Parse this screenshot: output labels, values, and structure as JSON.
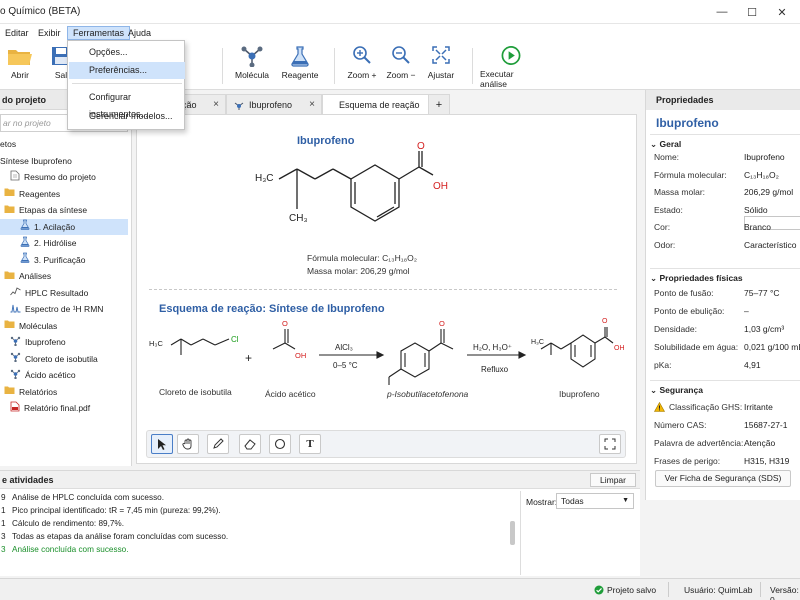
{
  "window": {
    "title": "o Químico (BETA)",
    "minimize": "—",
    "maximize": "☐",
    "close": "✕"
  },
  "menu": {
    "items": [
      "Editar",
      "Exibir",
      "Ferramentas",
      "Ajuda"
    ],
    "active": "Ferramentas"
  },
  "dropdown": {
    "items": [
      "Opções...",
      "Preferências...",
      "Configurar instrumentos...",
      "Gerenciar modelos..."
    ],
    "highlighted": "Preferências..."
  },
  "toolbar": {
    "abrir": "Abrir",
    "salvar": "Sal",
    "molecula": "Molécula",
    "reagente": "Reagente",
    "zoom_in": "Zoom +",
    "zoom_out": "Zoom −",
    "ajustar": "Ajustar",
    "executar": "Executar análise"
  },
  "left_panel": {
    "title": "do projeto",
    "search_placeholder": "ar no projeto",
    "tree": [
      {
        "label": "etos",
        "icon": "none"
      },
      {
        "label": "Síntese Ibuprofeno",
        "icon": "none"
      },
      {
        "label": "Resumo do projeto",
        "icon": "doc-icon"
      },
      {
        "label": "Reagentes",
        "icon": "folder-icon"
      },
      {
        "label": "Etapas da síntese",
        "icon": "folder-icon"
      },
      {
        "label": "1. Acilação",
        "icon": "flask-icon",
        "selected": true
      },
      {
        "label": "2. Hidrólise",
        "icon": "flask-icon"
      },
      {
        "label": "3. Purificação",
        "icon": "flask-icon"
      },
      {
        "label": "Análises",
        "icon": "folder-icon"
      },
      {
        "label": "HPLC Resultado",
        "icon": "chart-icon"
      },
      {
        "label": "Espectro de ¹H RMN",
        "icon": "spectrum-icon"
      },
      {
        "label": "Moléculas",
        "icon": "folder-icon"
      },
      {
        "label": "Ibuprofeno",
        "icon": "molecule-icon"
      },
      {
        "label": "Cloreto de isobutila",
        "icon": "molecule-icon"
      },
      {
        "label": "Ácido acético",
        "icon": "molecule-icon"
      },
      {
        "label": "Relatórios",
        "icon": "folder-icon"
      },
      {
        "label": "Relatório final.pdf",
        "icon": "pdf-icon"
      }
    ]
  },
  "tabs": [
    {
      "label": "lação"
    },
    {
      "label": "Ibuprofeno"
    },
    {
      "label": "Esquema de reação",
      "active": true
    },
    {
      "label": "+"
    }
  ],
  "canvas": {
    "molecule_title": "Ibuprofeno",
    "formula_label": "Fórmula molecular:",
    "formula": "C₁₃H₁₈O₂",
    "mass_text": "Massa molar: 206,29 g/mol",
    "scheme_title": "Esquema de reação: Síntese de Ibuprofeno",
    "reagent1": "Cloreto de isobutila",
    "reagent2": "Ácido acético",
    "plus": "+",
    "cond1_top": "AlCl₃",
    "cond1_bottom": "0–5 °C",
    "intermediate": "p-Isobutilacetofenona",
    "cond2_top": "H₂O, H₃O⁺",
    "cond2_bottom": "Refluxo",
    "product": "Ibuprofeno",
    "atom_labels": {
      "h3c": "H₃C",
      "ch3": "CH₃",
      "o": "O",
      "oh": "OH",
      "cl": "Cl"
    }
  },
  "drawing_tools": [
    "select-arrow-icon",
    "hand-icon",
    "pencil-icon",
    "eraser-icon",
    "circle-icon",
    "text-icon",
    "fit-screen-icon"
  ],
  "drawing_text_tool": "T",
  "properties": {
    "header": "Propriedades",
    "title": "Ibuprofeno",
    "sections": {
      "geral": "Geral",
      "fisicas": "Propriedades físicas",
      "seguranca": "Segurança"
    },
    "geral": [
      {
        "k": "Nome:",
        "v": "Ibuprofeno"
      },
      {
        "k": "Fórmula molecular:",
        "v": "C₁₃H₁₈O₂"
      },
      {
        "k": "Massa molar:",
        "v": "206,29 g/mol"
      },
      {
        "k": "Estado:",
        "v": "Sólido"
      },
      {
        "k": "Cor:",
        "v": "Branco"
      },
      {
        "k": "Odor:",
        "v": "Característico"
      }
    ],
    "fisicas": [
      {
        "k": "Ponto de fusão:",
        "v": "75–77 °C"
      },
      {
        "k": "Ponto de ebulição:",
        "v": "–"
      },
      {
        "k": "Densidade:",
        "v": "1,03 g/cm³"
      },
      {
        "k": "Solubilidade em água:",
        "v": "0,021 g/100 mL ("
      },
      {
        "k": "pKa:",
        "v": "4,91"
      }
    ],
    "seguranca": [
      {
        "k": "Classificação GHS:",
        "v": "Irritante"
      },
      {
        "k": "Número CAS:",
        "v": "15687-27-1"
      },
      {
        "k": "Palavra de advertência:",
        "v": "Atenção"
      },
      {
        "k": "Frases de perigo:",
        "v": "H315, H319"
      }
    ],
    "sds_button": "Ver Ficha de Segurança (SDS)"
  },
  "log": {
    "title": "e atividades",
    "clear_button": "Limpar",
    "filter_label": "Mostrar:",
    "filter_value": "Todas",
    "lines": [
      {
        "n": "9",
        "text": "Análise de HPLC concluída com sucesso."
      },
      {
        "n": "1",
        "text": "Pico principal identificado: tR = 7,45 min (pureza: 99,2%)."
      },
      {
        "n": "1",
        "text": "Cálculo de rendimento: 89,7%."
      },
      {
        "n": "3",
        "text": "Todas as etapas da análise foram concluídas com sucesso."
      },
      {
        "n": "3",
        "text": "Análise concluída com sucesso.",
        "ok": true
      }
    ]
  },
  "status": {
    "saved": "Projeto salvo",
    "user": "Usuário: QuimLab",
    "version": "Versão: 0"
  },
  "colors": {
    "accent": "#2f5fa5",
    "selection": "#cfe3fb",
    "success": "#1a8f2a",
    "oxygen": "#d42020",
    "chlorine": "#1a9c1a"
  }
}
